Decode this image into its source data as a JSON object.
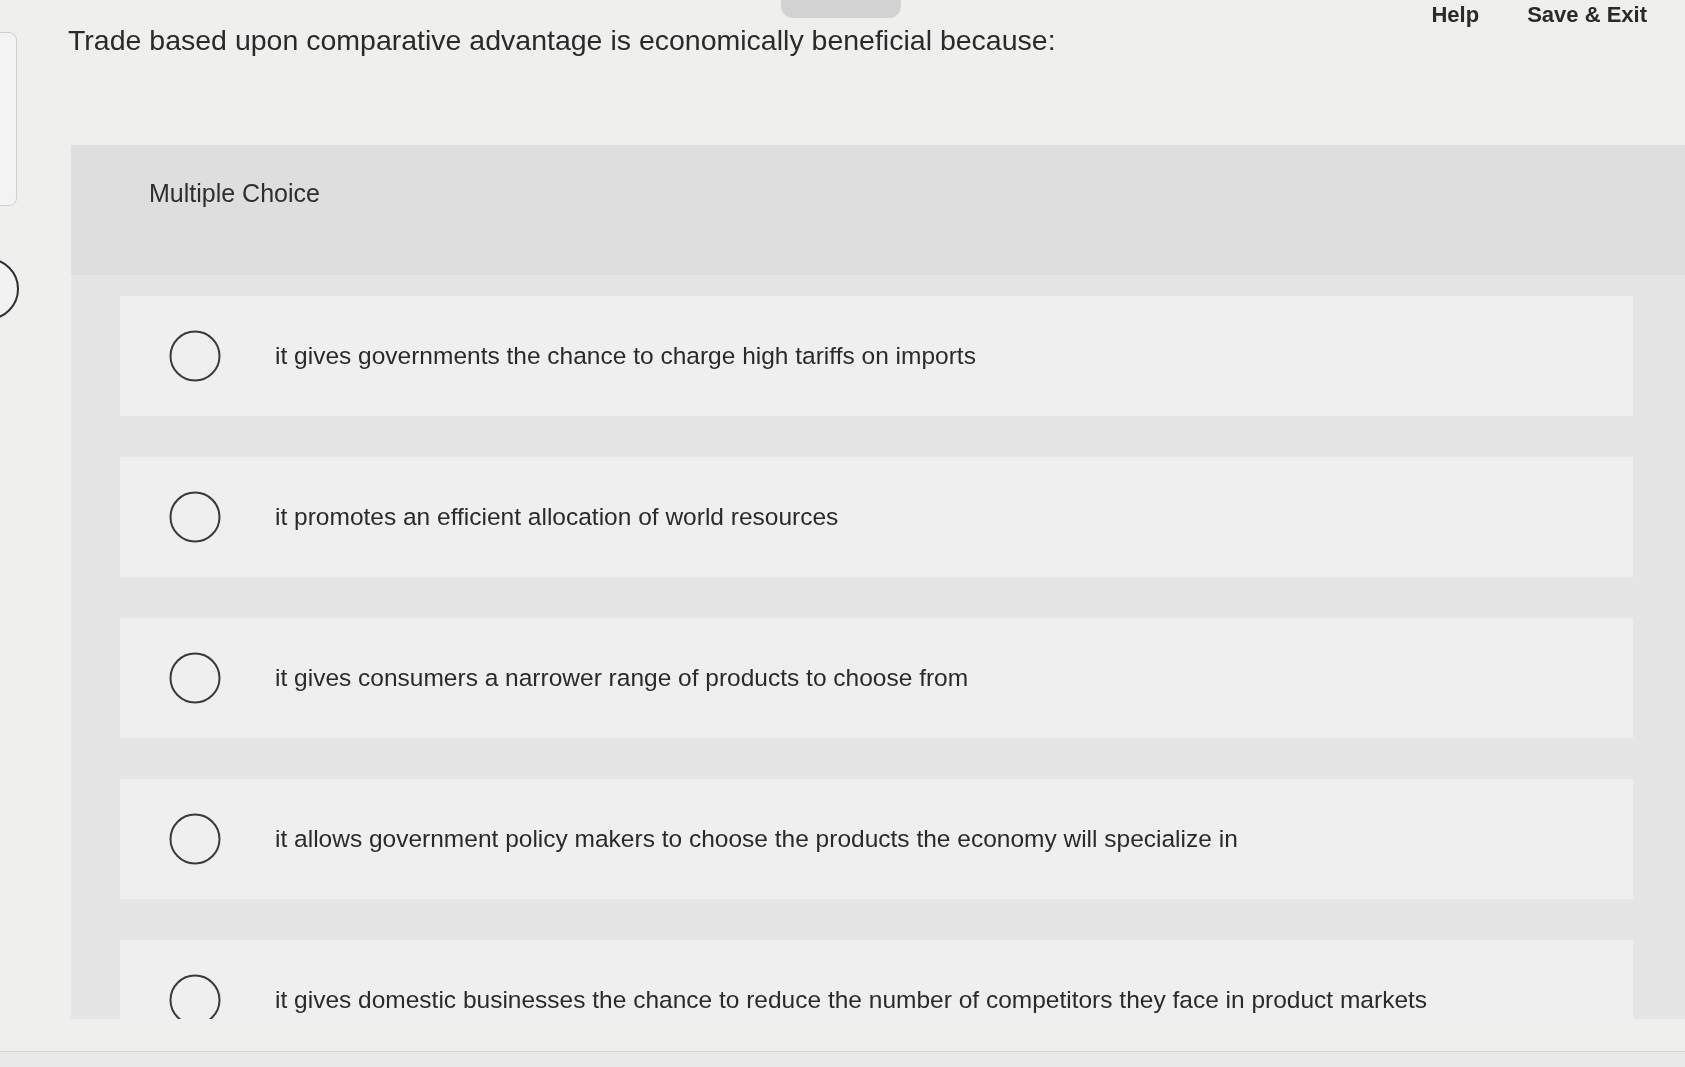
{
  "header": {
    "links": [
      "Help",
      "Save & Exit"
    ]
  },
  "question": {
    "text": "Trade based upon comparative advantage is economically beneficial because:"
  },
  "section": {
    "label": "Multiple Choice"
  },
  "options": [
    {
      "text": "it gives governments the chance to charge high tariffs on imports",
      "selected": false
    },
    {
      "text": "it promotes an efficient allocation of world resources",
      "selected": false
    },
    {
      "text": "it gives consumers a narrower range of products to choose from",
      "selected": false
    },
    {
      "text": "it allows government policy makers to choose the products the economy will specialize in",
      "selected": false
    },
    {
      "text": "it gives domestic businesses the chance to reduce the number of competitors they face in product markets",
      "selected": false
    }
  ]
}
